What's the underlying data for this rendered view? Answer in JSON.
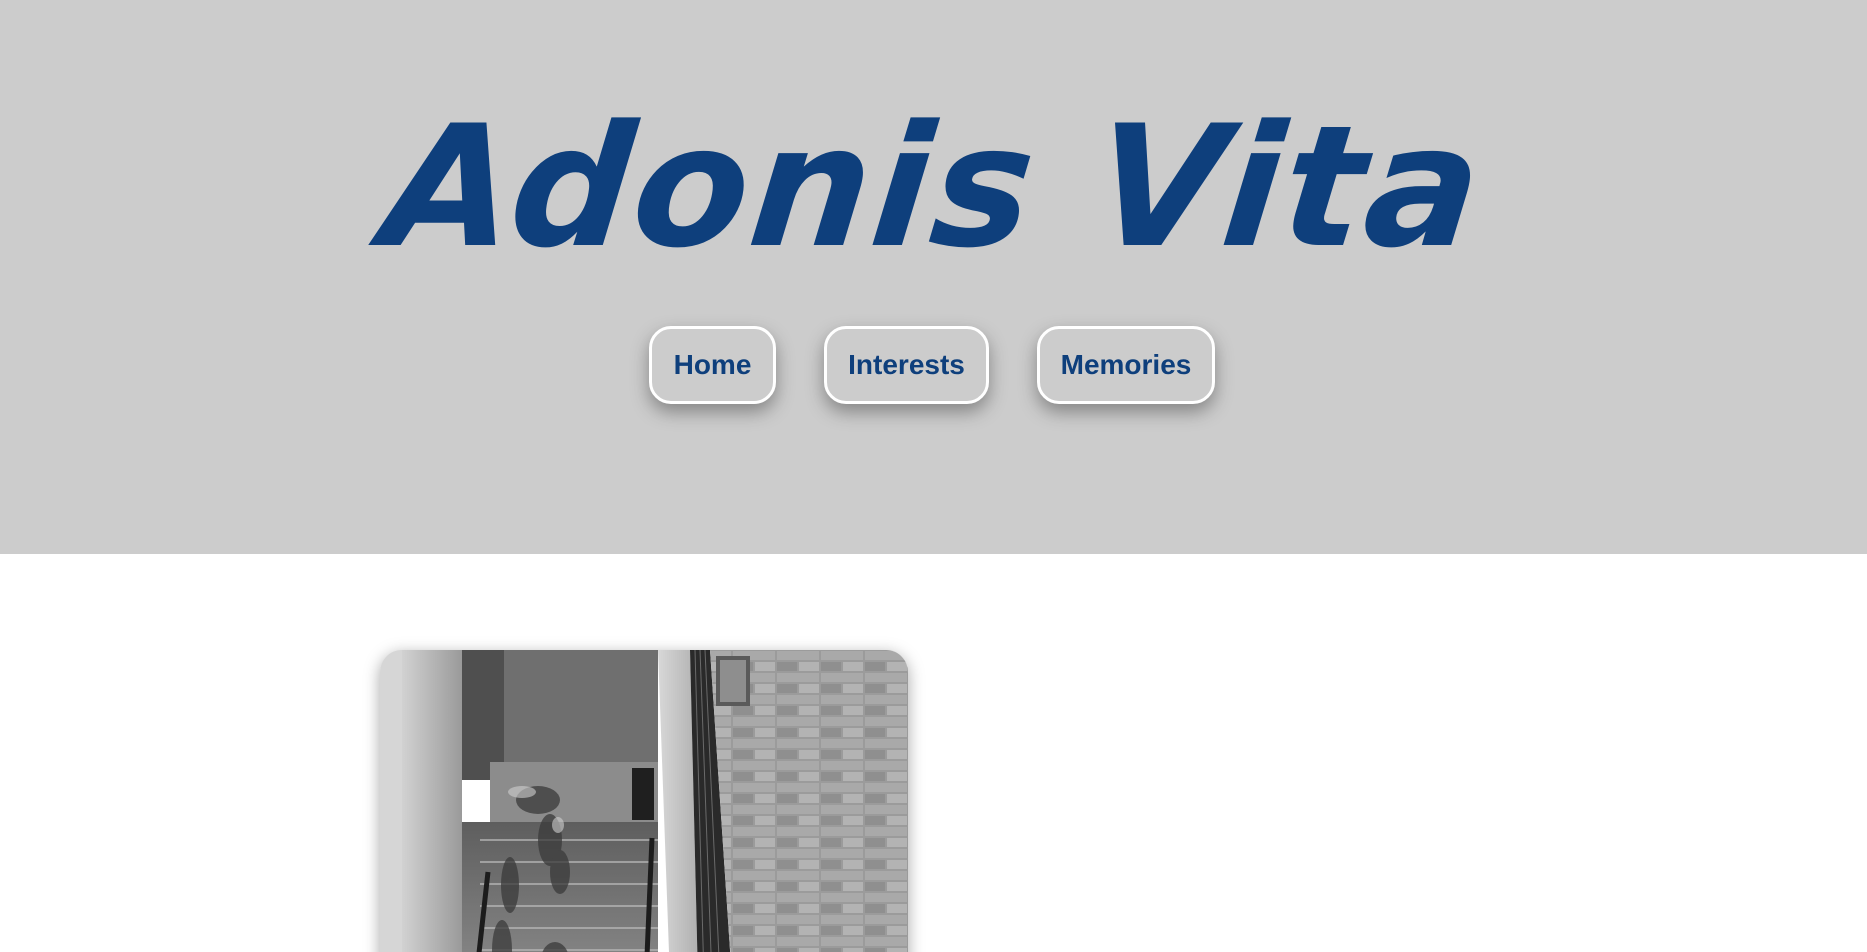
{
  "site": {
    "title": "Adonis Vita"
  },
  "nav": {
    "items": [
      {
        "label": "Home"
      },
      {
        "label": "Interests"
      },
      {
        "label": "Memories"
      }
    ]
  },
  "colors": {
    "hero_background": "#cccccc",
    "title": "#0e3f7c",
    "nav_border": "#ffffff",
    "page_background": "#ffffff"
  },
  "main": {
    "featured_photo": {
      "subject": "black-and-white aerial view of people on stairs beside a stone wall"
    }
  }
}
